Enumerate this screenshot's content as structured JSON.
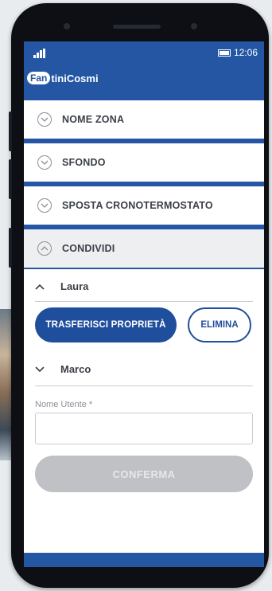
{
  "status": {
    "time": "12:06"
  },
  "brand": {
    "badge": "Fan",
    "name": "tiniCosmi"
  },
  "sections": [
    {
      "label": "NOME ZONA",
      "icon": "chevron-down-icon"
    },
    {
      "label": "SFONDO",
      "icon": "chevron-down-icon"
    },
    {
      "label": "SPOSTA CRONOTERMOSTATO",
      "icon": "chevron-down-icon"
    }
  ],
  "share": {
    "header": "CONDIVIDI",
    "users": [
      {
        "name": "Laura",
        "expanded": true
      },
      {
        "name": "Marco",
        "expanded": false
      }
    ],
    "transfer_label": "TRASFERISCI PROPRIETÀ",
    "delete_label": "ELIMINA",
    "username_label": "Nome Utente *",
    "username_value": "",
    "confirm_label": "CONFERMA"
  },
  "colors": {
    "brand_blue": "#2456a4",
    "button_blue": "#1f4e9c",
    "disabled": "#bfc1c4"
  }
}
